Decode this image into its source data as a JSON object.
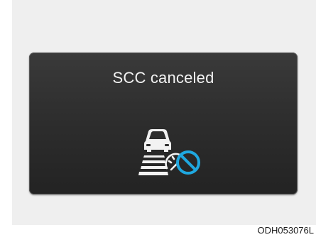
{
  "display": {
    "message": "SCC canceled",
    "icon": "scc-canceled-icon",
    "prohibit_color": "#1fa8e0"
  },
  "figure": {
    "code": "ODH053076L"
  }
}
